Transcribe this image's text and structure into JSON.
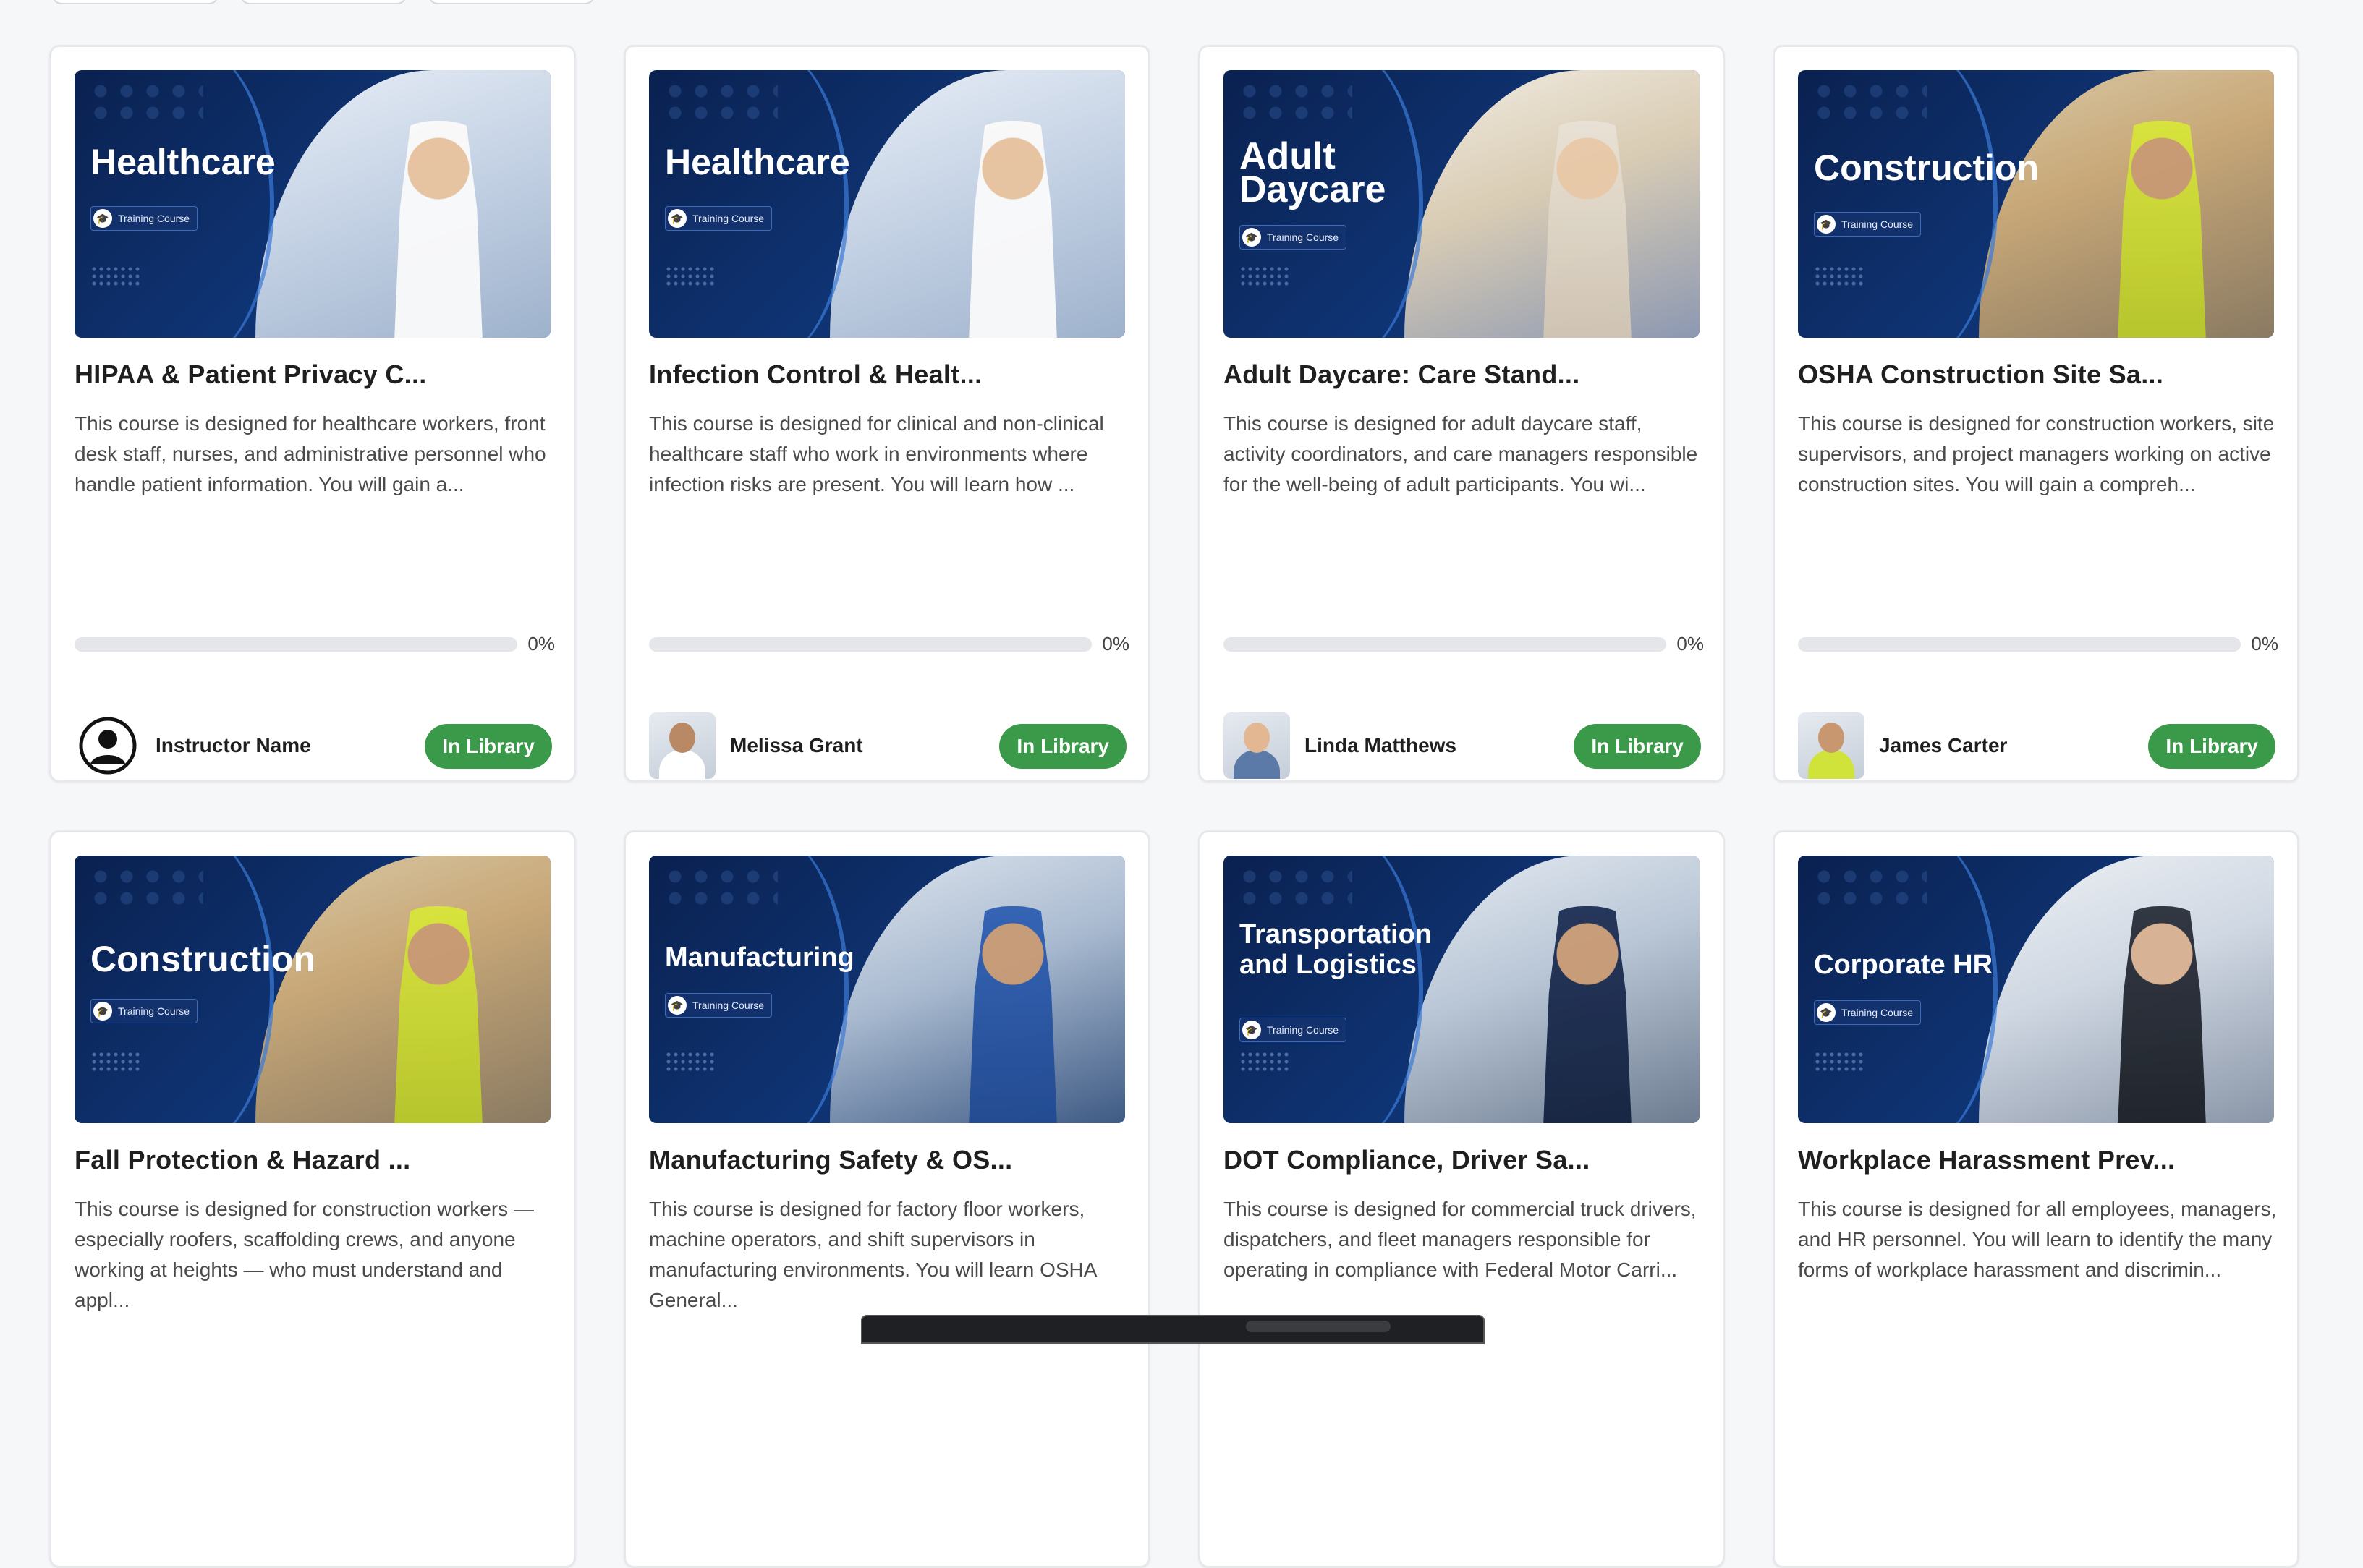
{
  "courses": [
    {
      "thumb_title": "Healthcare",
      "thumb_badge": "Training Course",
      "title": "HIPAA & Patient Privacy C...",
      "description": "This course is designed for healthcare workers, front desk staff, nurses, and administrative personnel who handle patient information. You will gain a...",
      "progress": 0,
      "progress_label": "0%",
      "instructor": "Instructor Name",
      "status": "In Library"
    },
    {
      "thumb_title": "Healthcare",
      "thumb_badge": "Training Course",
      "title": "Infection Control & Healt...",
      "description": "This course is designed for clinical and non-clinical healthcare staff who work in environments where infection risks are present. You will learn how ...",
      "progress": 0,
      "progress_label": "0%",
      "instructor": "Melissa Grant",
      "status": "In Library"
    },
    {
      "thumb_title": "Adult Daycare",
      "thumb_badge": "Training Course",
      "title": "Adult Daycare: Care Stand...",
      "description": "This course is designed for adult daycare staff, activity coordinators, and care managers responsible for the well-being of adult participants. You wi...",
      "progress": 0,
      "progress_label": "0%",
      "instructor": "Linda Matthews",
      "status": "In Library"
    },
    {
      "thumb_title": "Construction",
      "thumb_badge": "Training Course",
      "title": "OSHA Construction Site Sa...",
      "description": "This course is designed for construction workers, site supervisors, and project managers working on active construction sites. You will gain a compreh...",
      "progress": 0,
      "progress_label": "0%",
      "instructor": "James Carter",
      "status": "In Library"
    },
    {
      "thumb_title": "Construction",
      "thumb_badge": "Training Course",
      "title": "Fall Protection & Hazard ...",
      "description": "This course is designed for construction workers — especially roofers, scaffolding crews, and anyone working at heights — who must understand and appl..."
    },
    {
      "thumb_title": "Manufacturing",
      "thumb_badge": "Training Course",
      "title": "Manufacturing Safety & OS...",
      "description": "This course is designed for factory floor workers, machine operators, and shift supervisors in manufacturing environments. You will learn OSHA General..."
    },
    {
      "thumb_title": "Transportation and Logistics",
      "thumb_badge": "Training Course",
      "title": "DOT Compliance, Driver Sa...",
      "description": "This course is designed for commercial truck drivers, dispatchers, and fleet managers responsible for operating in compliance with Federal Motor Carri..."
    },
    {
      "thumb_title": "Corporate HR",
      "thumb_badge": "Training Course",
      "title": "Workplace Harassment Prev...",
      "description": "This course is designed for all employees, managers, and HR personnel. You will learn to identify the many forms of workplace harassment and discrimin..."
    }
  ],
  "colors": {
    "accent_green": "#3a9a4a",
    "thumb_navy": "#0f3474",
    "page_bg": "#f6f7f9"
  }
}
